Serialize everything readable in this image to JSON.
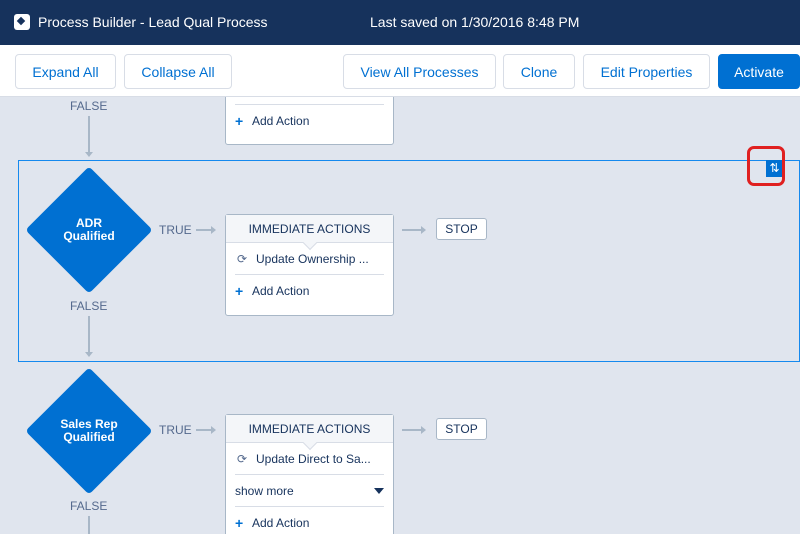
{
  "header": {
    "app_title": "Process Builder - Lead Qual Process",
    "saved_status": "Last saved on 1/30/2016 8:48 PM"
  },
  "toolbar": {
    "expand_all": "Expand All",
    "collapse_all": "Collapse All",
    "view_all_processes": "View All Processes",
    "clone": "Clone",
    "edit_properties": "Edit Properties",
    "activate": "Activate"
  },
  "flow": {
    "true_label": "TRUE",
    "false_label": "FALSE",
    "stop_label": "STOP",
    "immediate_actions_label": "IMMEDIATE ACTIONS",
    "add_action_label": "Add Action",
    "show_more_label": "show more",
    "criteria": [
      {
        "name": "ADR Qualified",
        "actions": [
          "Update Ownership ..."
        ]
      },
      {
        "name": "Sales Rep Qualified",
        "actions": [
          "Update Direct to Sa..."
        ]
      }
    ]
  },
  "colors": {
    "header_bg": "#16325c",
    "brand_blue": "#0070d2",
    "canvas_bg": "#e0e5ee",
    "highlight_red": "#e02020"
  },
  "icons": {
    "app": "process-builder-icon",
    "reorder": "reorder-arrows-icon",
    "update_record": "refresh-icon",
    "add": "plus-icon",
    "expand": "caret-down-icon"
  }
}
